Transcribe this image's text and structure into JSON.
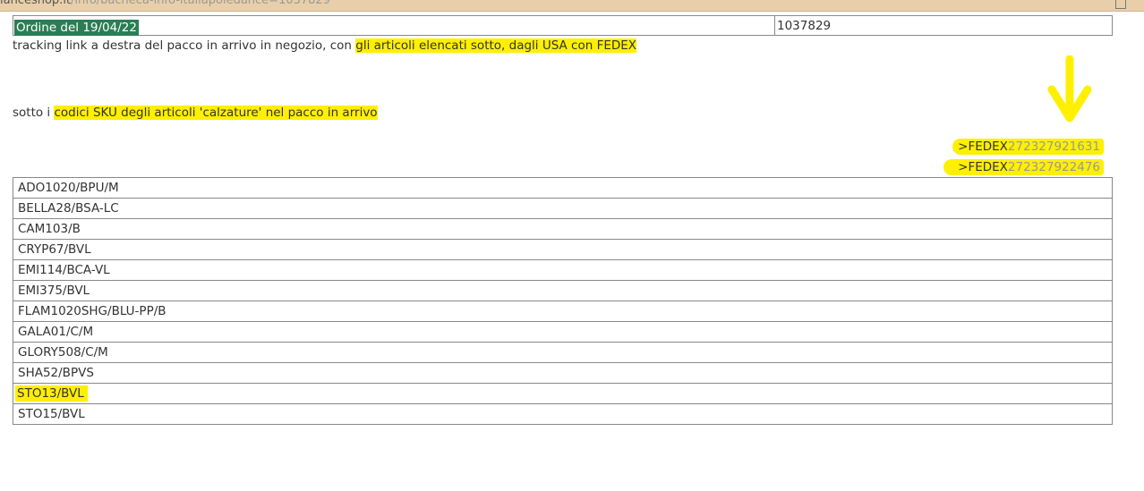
{
  "browser": {
    "url_visible": "ianceshop.it",
    "url_path": "/info/bacheca-info-italiapoledance=1037829"
  },
  "order": {
    "title": "Ordine del 19/04/22",
    "number": "1037829"
  },
  "tracking_line": {
    "prefix": "tracking link a destra del pacco in arrivo in negozio, con ",
    "highlight": "gli articoli elencati sotto, dagli USA con FEDEX"
  },
  "sku_intro": {
    "prefix": "sotto i ",
    "highlight": "codici SKU degli articoli 'calzature' nel pacco in arrivo"
  },
  "fedex": [
    {
      "label": ">FEDEX",
      "number": "272327921631"
    },
    {
      "label": ">FEDEX",
      "number": "272327922476"
    }
  ],
  "skus": [
    {
      "code": "ADO1020/BPU/M",
      "highlighted": false
    },
    {
      "code": "BELLA28/BSA-LC",
      "highlighted": false
    },
    {
      "code": "CAM103/B",
      "highlighted": false
    },
    {
      "code": "CRYP67/BVL",
      "highlighted": false
    },
    {
      "code": "EMI114/BCA-VL",
      "highlighted": false
    },
    {
      "code": "EMI375/BVL",
      "highlighted": false
    },
    {
      "code": "FLAM1020SHG/BLU-PP/B",
      "highlighted": false
    },
    {
      "code": "GALA01/C/M",
      "highlighted": false
    },
    {
      "code": "GLORY508/C/M",
      "highlighted": false
    },
    {
      "code": "SHA52/BPVS",
      "highlighted": false
    },
    {
      "code": "STO13/BVL",
      "highlighted": true
    },
    {
      "code": "STO15/BVL",
      "highlighted": false
    }
  ],
  "colors": {
    "highlight": "#ffef00",
    "order_title_bg": "#2a7d55",
    "annotation_arrow": "#ffef00"
  },
  "icons": {
    "annotation_arrow": "arrow-down-icon"
  }
}
